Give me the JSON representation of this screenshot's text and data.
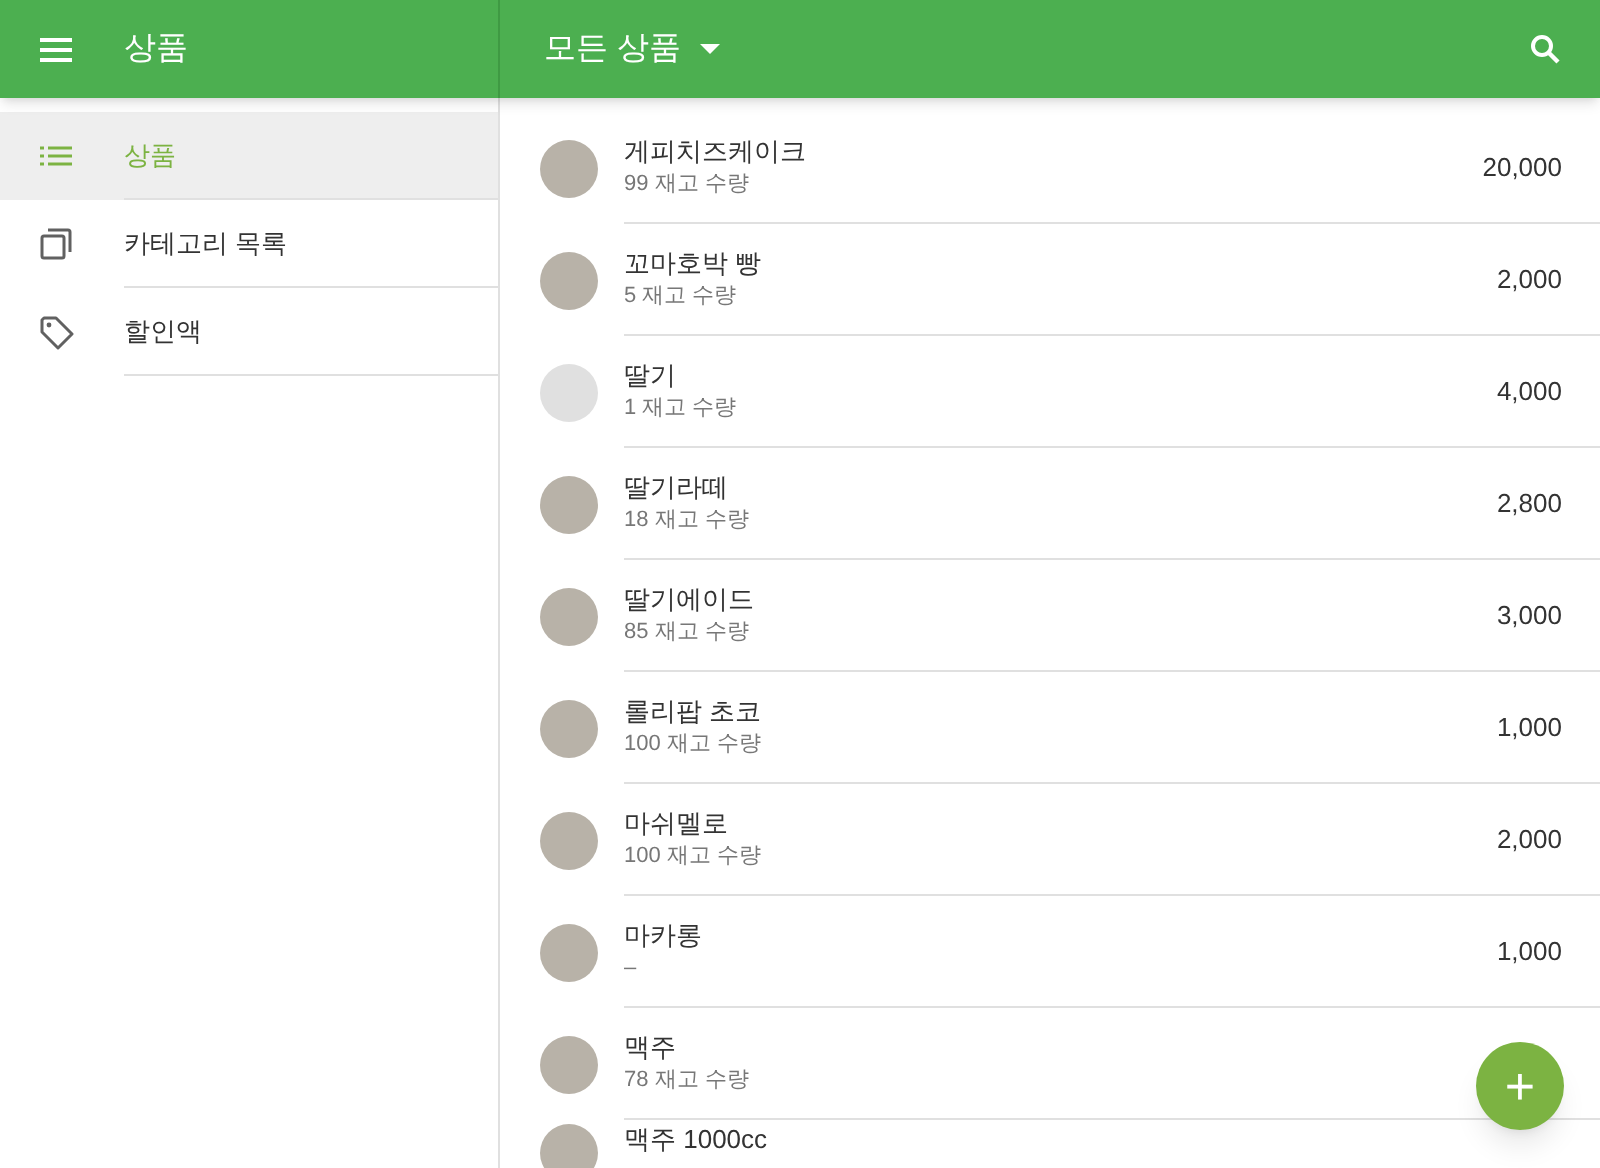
{
  "app_bar": {
    "title": "상품",
    "filter": "모든 상품"
  },
  "sidebar": {
    "items": [
      {
        "label": "상품",
        "kind": "list",
        "selected": true
      },
      {
        "label": "카테고리 목록",
        "kind": "copy",
        "selected": false
      },
      {
        "label": "할인액",
        "kind": "tag",
        "selected": false
      }
    ]
  },
  "products": [
    {
      "name": "게피치즈케이크",
      "stock": "99 재고 수량",
      "price": "20,000",
      "kind": "photo"
    },
    {
      "name": "꼬마호박 빵",
      "stock": "5 재고 수량",
      "price": "2,000",
      "kind": "photo"
    },
    {
      "name": "딸기",
      "stock": "1 재고 수량",
      "price": "4,000",
      "kind": "empty"
    },
    {
      "name": "딸기라떼",
      "stock": "18 재고 수량",
      "price": "2,800",
      "kind": "photo"
    },
    {
      "name": "딸기에이드",
      "stock": "85 재고 수량",
      "price": "3,000",
      "kind": "photo"
    },
    {
      "name": "롤리팝 초코",
      "stock": "100 재고 수량",
      "price": "1,000",
      "kind": "photo"
    },
    {
      "name": "마쉬멜로",
      "stock": "100 재고 수량",
      "price": "2,000",
      "kind": "photo"
    },
    {
      "name": "마카롱",
      "stock": "–",
      "price": "1,000",
      "kind": "photo"
    },
    {
      "name": "맥주",
      "stock": "78 재고 수량",
      "kind": "photo"
    },
    {
      "name": "맥주 1000cc",
      "kind": "photo"
    }
  ],
  "fab": {
    "label": "+"
  }
}
